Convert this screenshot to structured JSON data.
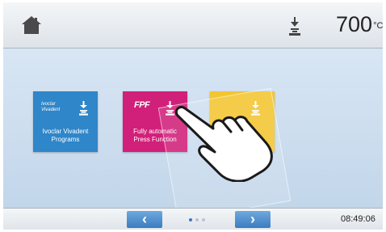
{
  "header": {
    "home_icon": "home-icon",
    "press_icon": "press-icon",
    "temperature": "700",
    "temperature_unit": "°C"
  },
  "tiles": [
    {
      "brand_line1": "Ivoclar",
      "brand_line2": "Vivadent",
      "label": "Ivoclar Vivadent Programs",
      "color": "#2f86c9",
      "icon": "press-icon"
    },
    {
      "brand": "FPF",
      "label": "Fully automatic Press Function",
      "color": "#d1207a",
      "icon": "press-icon"
    },
    {
      "label": "",
      "color": "#f3c530",
      "icon": "press-icon"
    }
  ],
  "gesture": {
    "icon": "touch-hand-icon"
  },
  "footer": {
    "prev_label": "‹",
    "next_label": "›",
    "page_count": 3,
    "active_page": 1,
    "time": "08:49:06"
  }
}
